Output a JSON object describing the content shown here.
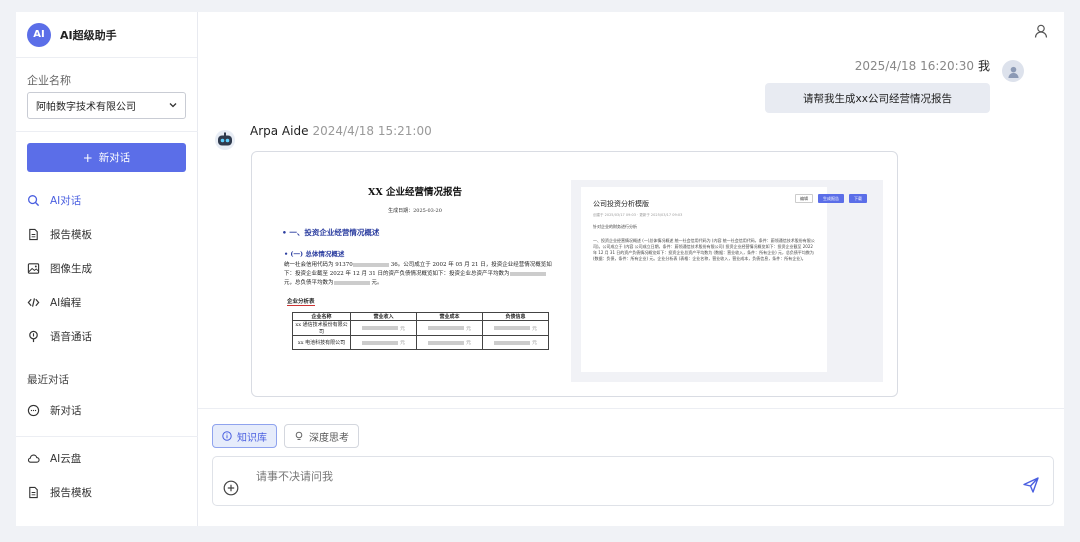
{
  "brand": {
    "logo_text": "AI",
    "name": "AI超级助手"
  },
  "company": {
    "label": "企业名称",
    "selected": "阿帕数字技术有限公司"
  },
  "new_chat_label": "新对话",
  "nav": [
    {
      "label": "AI对话",
      "icon": "search-icon",
      "active": true
    },
    {
      "label": "报告模板",
      "icon": "document-icon"
    },
    {
      "label": "图像生成",
      "icon": "image-icon"
    },
    {
      "label": "AI编程",
      "icon": "code-icon"
    },
    {
      "label": "语音通话",
      "icon": "mic-icon"
    }
  ],
  "recent": {
    "label": "最近对话",
    "items": [
      {
        "label": "新对话",
        "icon": "chat-icon"
      }
    ]
  },
  "bottom_nav": [
    {
      "label": "AI云盘",
      "icon": "cloud-icon"
    },
    {
      "label": "报告模板",
      "icon": "document-icon"
    }
  ],
  "chat": {
    "user": {
      "time": "2025/4/18 16:20:30",
      "name": "我",
      "message": "请帮我生成xx公司经营情况报告"
    },
    "bot": {
      "name": "Arpa Aide",
      "time": "2024/4/18 15:21:00"
    }
  },
  "report": {
    "title": "XX 企业经营情况报告",
    "date": "生成日期：2025-03-20",
    "h1": "一、投资企业经营情况概述",
    "h2": "(一) 总体情况概述",
    "body1": "统一社会信用代码为 91370",
    "body2": "36。公司成立于 2002 年 05 月 21 日，投资企业经营情况概览如下：投资企业截至 2022 年 12 月 31 日的资产负债情况概览如下：投资企业总资产平均数为",
    "body3": "元，总负债平均数为",
    "body4": "元。",
    "table_title": "企业分析表",
    "table_headers": [
      "企业名称",
      "营业收入",
      "营业成本",
      "负债信息"
    ],
    "table_rows": [
      {
        "name": "xx 通信技术股份有限公司",
        "unit": "元"
      },
      {
        "name": "xx 电池科技有限公司",
        "unit": "元"
      }
    ]
  },
  "preview": {
    "toolbar": [
      "编辑",
      "生成报告",
      "下载"
    ],
    "title": "公司投资分析模版",
    "meta": "创建于 2025/03/17 09:03 · 更新于 2025/03/17 09:03",
    "sub": "针对企业的财务进行分析",
    "body": "一、投资企业经营情况概述 (一)总体情况概述 统一社会信用代码为 (内容 统一社会信用代码，条件：蔚领通信技术股份有限公司)。公司成立于 (内容 公司成立日期，条件：蔚领通信技术股份有限公司) 投资企业经营情况概览如下：投资企业截至 2022 年 12 月 31 日的资产负债情况概览如下：投资企业总资产平均数为 (数据：营业收入，条件：所有企业) 元，总负债平均数为 (数据：负债，条件：所有企业) 元。企业分析表 (表格：企业名称，营业收入，营业成本，负债信息，条件：所有企业)。"
  },
  "chips": {
    "knowledge": "知识库",
    "think": "深度思考"
  },
  "input": {
    "placeholder": "请事不决请问我"
  }
}
